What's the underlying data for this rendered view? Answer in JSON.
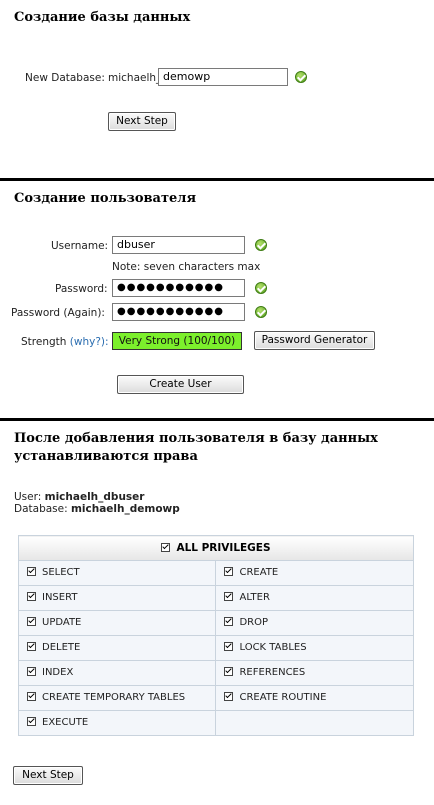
{
  "section1": {
    "title": "Создание базы данных",
    "label": "New Database:",
    "prefix": "michaelh_",
    "value": "demowp",
    "button": "Next Step"
  },
  "section2": {
    "title": "Создание пользователя",
    "username_label": "Username:",
    "username_value": "dbuser",
    "note": "Note: seven characters max",
    "password_label": "Password:",
    "password_value": "●●●●●●●●●●●",
    "password_again_label": "Password (Again):",
    "password_again_value": "●●●●●●●●●●●",
    "strength_label": "Strength",
    "why_label": "(why?):",
    "strength_value": "Very Strong (100/100)",
    "strength_color": "#7cf02c",
    "generator_button": "Password Generator",
    "create_button": "Create User"
  },
  "section3": {
    "title_line1": "После добавления пользователя в базу данных",
    "title_line2": "устанавливаются права",
    "user_label": "User:",
    "user_value": "michaelh_dbuser",
    "database_label": "Database:",
    "database_value": "michaelh_demowp",
    "all_privileges": "ALL PRIVILEGES",
    "privileges": [
      [
        "SELECT",
        "CREATE"
      ],
      [
        "INSERT",
        "ALTER"
      ],
      [
        "UPDATE",
        "DROP"
      ],
      [
        "DELETE",
        "LOCK TABLES"
      ],
      [
        "INDEX",
        "REFERENCES"
      ],
      [
        "CREATE TEMPORARY TABLES",
        "CREATE ROUTINE"
      ],
      [
        "EXECUTE",
        ""
      ]
    ],
    "button": "Next Step"
  }
}
